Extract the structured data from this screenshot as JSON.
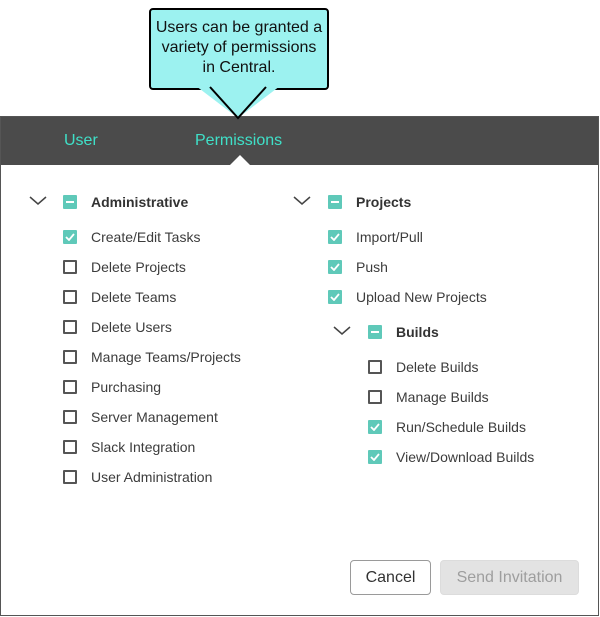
{
  "callout": {
    "text": "Users can be granted a variety of permissions in Central."
  },
  "tabs": [
    {
      "label": "User",
      "active": false
    },
    {
      "label": "Permissions",
      "active": true
    }
  ],
  "colors": {
    "accent": "#5fc9b9",
    "tab_text": "#3fe0c8",
    "tab_bar": "#4b4b4b",
    "callout": "#9cf2f0"
  },
  "administrative": {
    "label": "Administrative",
    "state": "indeterminate",
    "items": [
      {
        "label": "Create/Edit Tasks",
        "checked": true
      },
      {
        "label": "Delete Projects",
        "checked": false
      },
      {
        "label": "Delete Teams",
        "checked": false
      },
      {
        "label": "Delete Users",
        "checked": false
      },
      {
        "label": "Manage Teams/Projects",
        "checked": false
      },
      {
        "label": "Purchasing",
        "checked": false
      },
      {
        "label": "Server Management",
        "checked": false
      },
      {
        "label": "Slack Integration",
        "checked": false
      },
      {
        "label": "User Administration",
        "checked": false
      }
    ]
  },
  "projects": {
    "label": "Projects",
    "state": "indeterminate",
    "items": [
      {
        "label": "Import/Pull",
        "checked": true
      },
      {
        "label": "Push",
        "checked": true
      },
      {
        "label": "Upload New Projects",
        "checked": true
      }
    ],
    "builds": {
      "label": "Builds",
      "state": "indeterminate",
      "items": [
        {
          "label": "Delete Builds",
          "checked": false
        },
        {
          "label": "Manage Builds",
          "checked": false
        },
        {
          "label": "Run/Schedule Builds",
          "checked": true
        },
        {
          "label": "View/Download Builds",
          "checked": true
        }
      ]
    }
  },
  "buttons": {
    "cancel": "Cancel",
    "send": "Send Invitation"
  }
}
